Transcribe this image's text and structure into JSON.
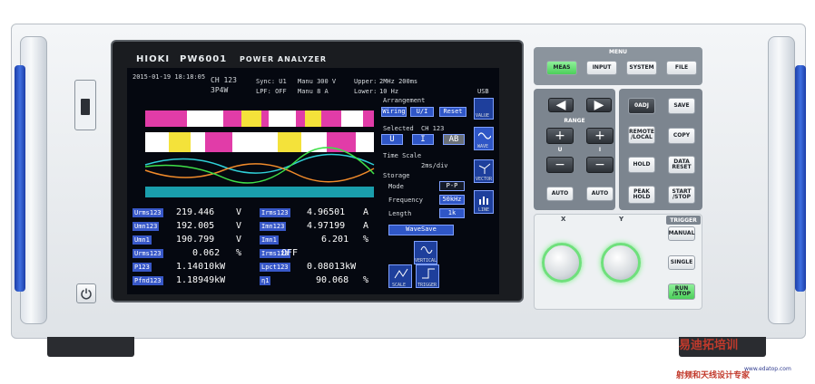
{
  "device": {
    "brand": "HIOKI",
    "model": "PW6001",
    "model_desc": "POWER ANALYZER"
  },
  "status": {
    "datetime": "2015-01-19 18:18:05",
    "ch": "CH 123",
    "wiring": "3P4W",
    "sync": "Sync: U1",
    "lpf": "LPF: OFF",
    "manu_v": "Manu 300 V",
    "manu_a": "Manu   8 A",
    "upper": "Upper:",
    "upper_val": "2MHz 200ms",
    "lower": "Lower:",
    "lower_val": "10 Hz",
    "usb": "USB"
  },
  "measurements": {
    "left": [
      {
        "label": "Urms123",
        "value": "219.446",
        "unit": "V"
      },
      {
        "label": "Umn123",
        "value": "192.005",
        "unit": "V"
      },
      {
        "label": "Umn1",
        "value": "190.799",
        "unit": "V"
      },
      {
        "label": "Urms123",
        "value": "0.062",
        "unit": "%"
      },
      {
        "label": "P123",
        "value": "1.14010kW",
        "unit": ""
      },
      {
        "label": "Pfnd123",
        "value": "1.18949kW",
        "unit": ""
      }
    ],
    "right": [
      {
        "label": "Irms123",
        "value": "4.96501",
        "unit": "A"
      },
      {
        "label": "Imn123",
        "value": "4.97199",
        "unit": "A"
      },
      {
        "label": "Imn1",
        "value": "6.201",
        "unit": "%"
      },
      {
        "label": "Irms123",
        "value": "OFF",
        "unit": ""
      },
      {
        "label": "Lpct123",
        "value": "0.08013kW",
        "unit": ""
      },
      {
        "label": "η1",
        "value": "90.068",
        "unit": "%"
      }
    ]
  },
  "settings": {
    "arrangement": "Arrangement",
    "wiring_btn": "Wiring",
    "ui_btn": "U/I",
    "reset_btn": "Reset",
    "selected": "Selected",
    "selected_ch": "CH 123",
    "u_btn": "U",
    "i_btn": "I",
    "ab_btn": "AB",
    "time_scale": "Time Scale",
    "time_scale_val": "2ms/div",
    "storage": "Storage",
    "mode": "Mode",
    "mode_val": "P-P",
    "frequency": "Frequency",
    "frequency_val": "50kHz",
    "length": "Length",
    "length_val": "1k",
    "wavesave_btn": "WaveSave"
  },
  "side_icons": {
    "value": "VALUE",
    "wave": "WAVE",
    "vector": "VECTOR",
    "line": "LINE",
    "vertical": "VERTICAL",
    "scale": "SCALE",
    "trigger": "TRIGGER"
  },
  "menu": {
    "title": "MENU",
    "meas": "MEAS",
    "input": "INPUT",
    "system": "SYSTEM",
    "file": "FILE"
  },
  "range": {
    "label": "RANGE",
    "u": "U",
    "i": "I",
    "auto1": "AUTO",
    "auto2": "AUTO"
  },
  "keys": {
    "zero_adj": "0ADJ",
    "save": "SAVE",
    "remote_local": "REMOTE /LOCAL",
    "copy": "COPY",
    "hold": "HOLD",
    "data_reset": "DATA RESET",
    "peak_hold": "PEAK HOLD",
    "start_stop": "START /STOP",
    "x": "X",
    "y": "Y",
    "trigger": "TRIGGER",
    "manual": "MANUAL",
    "single": "SINGLE",
    "run_stop": "RUN /STOP"
  },
  "watermark": {
    "top": "易迪拓培训",
    "site": "www.edatop.com",
    "bottom": "射频和天线设计专家"
  },
  "colors": {
    "accent_green": "#6fe07c",
    "screen_blue": "#2f56c6"
  }
}
